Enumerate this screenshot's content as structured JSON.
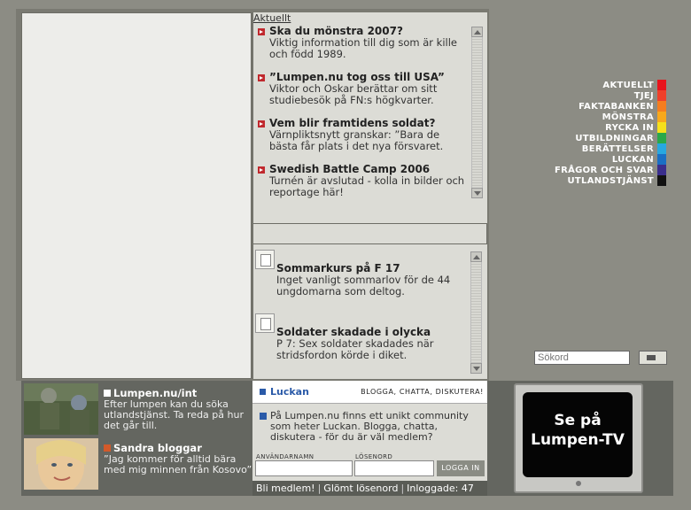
{
  "news": {
    "section_link": "Aktuellt",
    "items": [
      {
        "title": "Ska du mönstra 2007?",
        "text": "Viktig information till dig som är kille och född 1989."
      },
      {
        "title": "”Lumpen.nu tog oss till USA”",
        "text": "Viktor och Oskar berättar om sitt studiebesök på FN:s högkvarter."
      },
      {
        "title": "Vem blir framtidens soldat?",
        "text": "Värnpliktsnytt granskar: ”Bara de bästa får plats i det nya försvaret."
      },
      {
        "title": "Swedish Battle Camp 2006",
        "text": "Turnén är avslutad - kolla in bilder och reportage här!"
      }
    ]
  },
  "kurs": {
    "items": [
      {
        "title": "Sommarkurs på F 17",
        "text": "Inget vanligt sommarlov för de 44 ungdomarna som deltog."
      },
      {
        "title": "Soldater skadade i olycka",
        "text": "P 7: Sex soldater skadades när stridsfordon körde i diket."
      }
    ]
  },
  "menu": {
    "items": [
      {
        "label": "AKTUELLT",
        "color": "#e8141c"
      },
      {
        "label": "TJEJ",
        "color": "#f0402a"
      },
      {
        "label": "FAKTABANKEN",
        "color": "#f57d1f"
      },
      {
        "label": "MÖNSTRA",
        "color": "#f7a81b"
      },
      {
        "label": "RYCKA IN",
        "color": "#f5e01b"
      },
      {
        "label": "UTBILDNINGAR",
        "color": "#2aa84a"
      },
      {
        "label": "BERÄTTELSER",
        "color": "#27a8e0"
      },
      {
        "label": "LUCKAN",
        "color": "#1a6fc4"
      },
      {
        "label": "FRÅGOR OCH SVAR",
        "color": "#3a2e8c"
      },
      {
        "label": "UTLANDSTJÄNST",
        "color": "#111111"
      }
    ]
  },
  "search": {
    "placeholder": "Sökord"
  },
  "promos": [
    {
      "title": "Lumpen.nu/int",
      "text": "Efter lumpen kan du söka utlandstjänst. Ta reda på hur det går till.",
      "icon": "arrow-right-icon"
    },
    {
      "title": "Sandra bloggar",
      "text": "”Jag kommer för alltid bära med mig minnen från Kosovo”",
      "icon": "arrow-right-icon"
    }
  ],
  "luckan": {
    "title": "Luckan",
    "tagline": "BLOGGA, CHATTA, DISKUTERA!",
    "text": "På Lumpen.nu finns ett unikt community som heter Luckan. Blogga, chatta, diskutera - för du är väl medlem?",
    "username_label": "ANVÄNDARNAMN",
    "password_label": "LÖSENORD",
    "login_button": "LOGGA IN"
  },
  "footer": {
    "join": "Bli medlem!",
    "forgot": "Glömt lösenord",
    "online": "Inloggade: 47"
  },
  "tv": {
    "line1": "Se på",
    "line2": "Lumpen-TV"
  }
}
